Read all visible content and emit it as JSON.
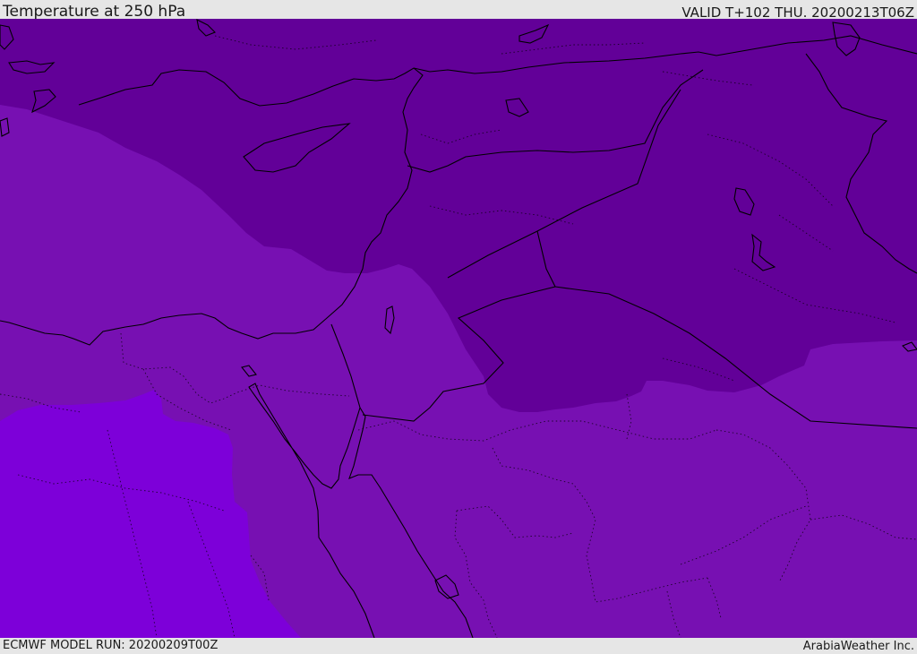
{
  "header": {
    "title": "Temperature at 250 hPa",
    "valid": "VALID T+102 THU. 20200213T06Z"
  },
  "footer": {
    "model_run": "ECMWF MODEL RUN: 20200209T00Z",
    "credit": "ArabiaWeather Inc."
  },
  "map": {
    "field": "Temperature at 250 hPa",
    "colors": {
      "band_coldest": "#620098",
      "band_middle": "#7710b2",
      "band_warmest": "#7d00d9",
      "coastline": "#000000"
    }
  }
}
